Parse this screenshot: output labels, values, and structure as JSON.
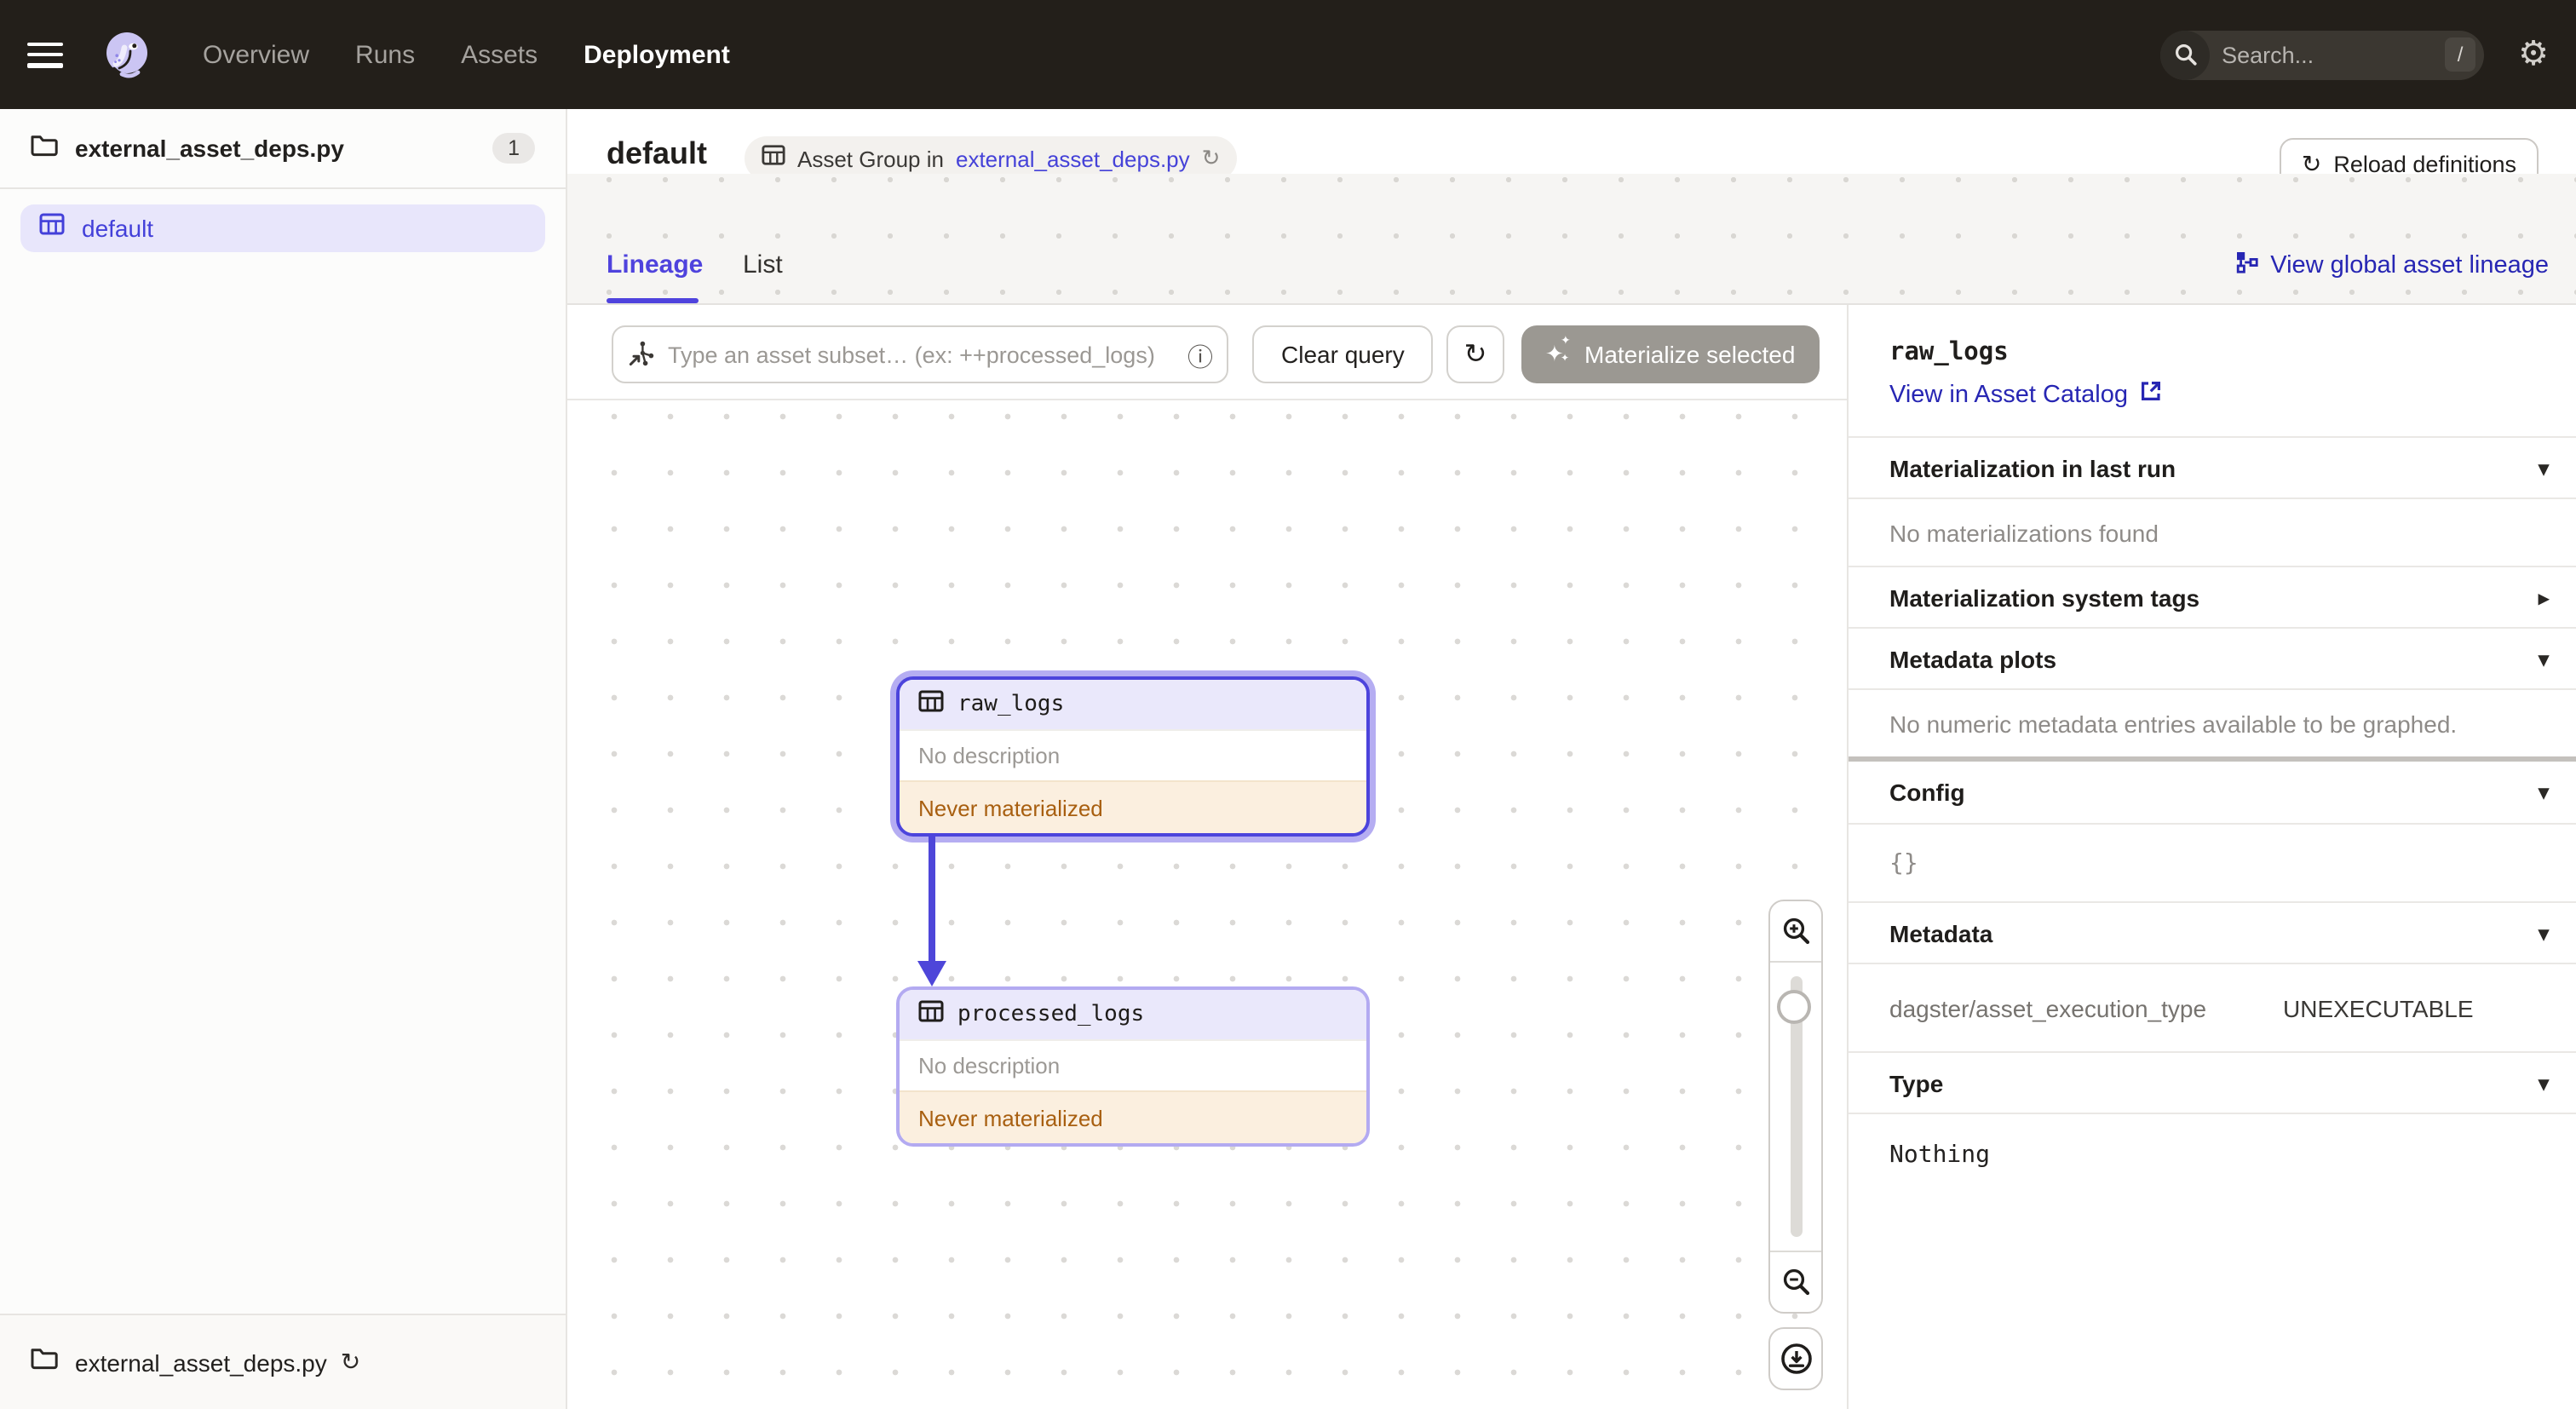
{
  "nav": {
    "links": [
      {
        "label": "Overview"
      },
      {
        "label": "Runs"
      },
      {
        "label": "Assets"
      },
      {
        "label": "Deployment"
      }
    ],
    "search": {
      "placeholder": "Search...",
      "shortcut": "/"
    }
  },
  "sidebar": {
    "top_item": {
      "label": "external_asset_deps.py",
      "count": "1"
    },
    "group_item": {
      "label": "default"
    },
    "bottom_item": {
      "label": "external_asset_deps.py"
    }
  },
  "header": {
    "title": "default",
    "tag_prefix": "Asset Group in",
    "tag_link": "external_asset_deps.py",
    "reload_label": "Reload definitions"
  },
  "tabs": {
    "lineage": "Lineage",
    "list": "List",
    "global_link": "View global asset lineage"
  },
  "toolbar": {
    "query_placeholder": "Type an asset subset… (ex: ++processed_logs)",
    "clear_label": "Clear query",
    "materialize_label": "Materialize selected"
  },
  "graph": {
    "nodes": [
      {
        "name": "raw_logs",
        "description": "No description",
        "status": "Never materialized",
        "selected": true
      },
      {
        "name": "processed_logs",
        "description": "No description",
        "status": "Never materialized",
        "selected": false
      }
    ]
  },
  "panel": {
    "title": "raw_logs",
    "catalog_link": "View in Asset Catalog",
    "sections": [
      {
        "title": "Materialization in last run",
        "caret": "down"
      },
      {
        "text": "No materializations found"
      },
      {
        "title": "Materialization system tags",
        "caret": "right"
      },
      {
        "title": "Metadata plots",
        "caret": "down"
      },
      {
        "text": "No numeric metadata entries available to be graphed."
      },
      {
        "title": "Config",
        "caret": "down"
      },
      {
        "text": "{}"
      },
      {
        "title": "Metadata",
        "caret": "down"
      },
      {
        "key": "dagster/asset_execution_type",
        "value": "UNEXECUTABLE"
      },
      {
        "title": "Type",
        "caret": "down"
      },
      {
        "text": "Nothing"
      }
    ]
  },
  "icons": {
    "refresh": "↻",
    "info": "ⓘ",
    "gear": "⚙",
    "caret_down": "▾",
    "caret_right": "▸",
    "sparkle": "✦"
  },
  "colors": {
    "nav_bg": "#231F1A",
    "accent": "#4F43DD",
    "link_navy": "#2726B3",
    "selected_halo": "#B5ADF2",
    "node_header_bg": "#EAE8FB",
    "status_text": "#A85F10",
    "status_bg": "#FBEFDF",
    "sidebar_selected_bg": "#E8E6FB",
    "materialize_disabled_bg": "#9B9892"
  }
}
